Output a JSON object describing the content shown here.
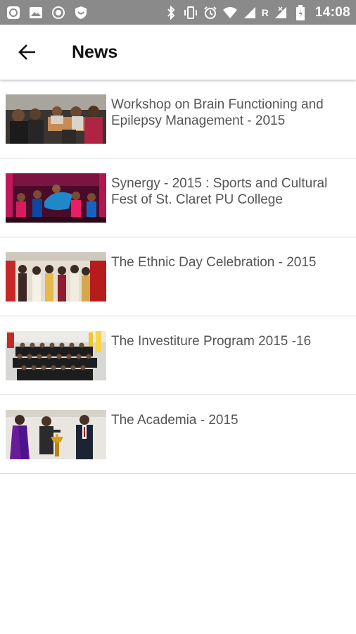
{
  "status_bar": {
    "time": "14:08",
    "network_letter": "R",
    "icons": [
      "app-notification-icon",
      "image-notification-icon",
      "record-icon",
      "shield-icon",
      "bluetooth-icon",
      "vibrate-icon",
      "alarm-icon",
      "wifi-icon",
      "signal-icon",
      "roaming-signal-icon",
      "battery-icon"
    ]
  },
  "app_bar": {
    "title": "News",
    "back_icon": "arrow-left-icon"
  },
  "news": [
    {
      "title": "Workshop on Brain Functioning and Epilepsy Management - 2015",
      "thumbnail": "workshop-photo"
    },
    {
      "title": "Synergy - 2015 : Sports and Cultural Fest of St. Claret PU College",
      "thumbnail": "dance-performance-photo"
    },
    {
      "title": "The Ethnic Day Celebration - 2015",
      "thumbnail": "ethnic-day-photo"
    },
    {
      "title": "The Investiture Program 2015 -16",
      "thumbnail": "group-photo"
    },
    {
      "title": "The Academia - 2015",
      "thumbnail": "lamp-lighting-photo"
    }
  ],
  "colors": {
    "status_bar": "#8a8a8a",
    "title_text": "#111111",
    "item_text": "#555555",
    "divider": "#d9d9d9"
  }
}
